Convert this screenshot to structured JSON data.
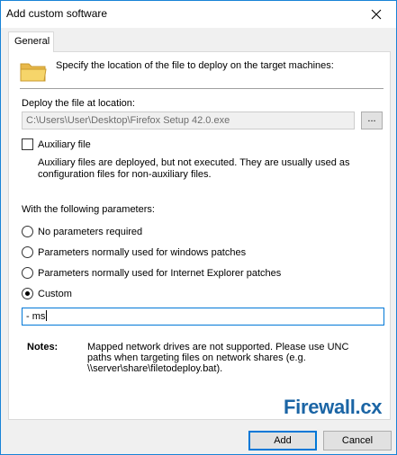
{
  "window": {
    "title": "Add custom software"
  },
  "tabs": [
    {
      "label": "General",
      "selected": true
    }
  ],
  "general": {
    "intro": "Specify the location of the file to deploy on the target machines:",
    "deploy_label": "Deploy the file at location:",
    "file_path": "C:\\Users\\User\\Desktop\\Firefox Setup 42.0.exe",
    "browse_label": "...",
    "auxiliary": {
      "label": "Auxiliary file",
      "checked": false,
      "description": "Auxiliary files are deployed, but not executed. They are usually used as configuration files for non-auxiliary files."
    },
    "parameters_label": "With the following parameters:",
    "options": [
      {
        "label": "No parameters required",
        "checked": false
      },
      {
        "label": "Parameters normally used for windows patches",
        "checked": false
      },
      {
        "label": "Parameters normally used for Internet Explorer patches",
        "checked": false
      },
      {
        "label": "Custom",
        "checked": true
      }
    ],
    "custom_value": "- ms",
    "notes_label": "Notes:",
    "notes_text": "Mapped network drives are not supported. Please use UNC paths when targeting files on network shares (e.g. \\\\server\\share\\filetodeploy.bat)."
  },
  "brand": {
    "name": "Firewall",
    "dot": ".",
    "ext": "cx"
  },
  "buttons": {
    "add": "Add",
    "cancel": "Cancel"
  },
  "colors": {
    "accent": "#0078d7",
    "window_border": "#1883d7",
    "brand": "#1b65a5"
  }
}
